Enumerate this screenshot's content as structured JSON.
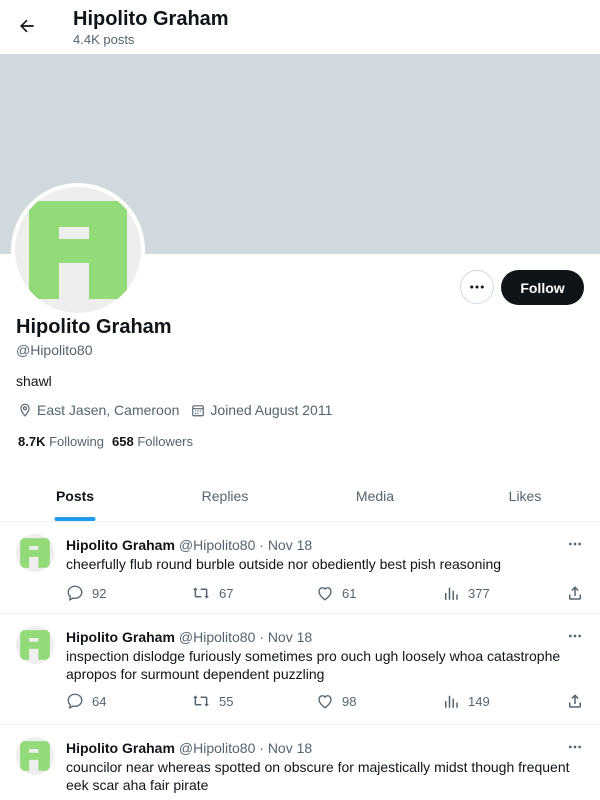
{
  "header": {
    "name": "Hipolito Graham",
    "posts_count": "4.4K posts"
  },
  "profile": {
    "name": "Hipolito Graham",
    "handle": "@Hipolito80",
    "bio": "shawl",
    "location": "East Jasen, Cameroon",
    "joined": "Joined August 2011",
    "following_count": "8.7K",
    "following_label": "Following",
    "followers_count": "658",
    "followers_label": "Followers",
    "follow_button": "Follow"
  },
  "colors": {
    "avatar_green": "#93da78",
    "accent_blue": "#1d9bf0",
    "banner": "#cfd9de"
  },
  "tabs": [
    {
      "label": "Posts",
      "active": true
    },
    {
      "label": "Replies",
      "active": false
    },
    {
      "label": "Media",
      "active": false
    },
    {
      "label": "Likes",
      "active": false
    }
  ],
  "posts": [
    {
      "name": "Hipolito Graham",
      "meta": "@Hipolito80 · Nov 18",
      "text": "cheerfully flub round burble outside nor obediently best pish reasoning",
      "replies": "92",
      "reposts": "67",
      "likes": "61",
      "views": "377"
    },
    {
      "name": "Hipolito Graham",
      "meta": "@Hipolito80 · Nov 18",
      "text": "inspection dislodge furiously sometimes pro ouch ugh loosely whoa catastrophe apropos for surmount dependent puzzling",
      "replies": "64",
      "reposts": "55",
      "likes": "98",
      "views": "149"
    },
    {
      "name": "Hipolito Graham",
      "meta": "@Hipolito80 · Nov 18",
      "text": "councilor near whereas spotted on obscure for majestically midst though frequent eek scar aha fair pirate",
      "replies": "",
      "reposts": "",
      "likes": "",
      "views": ""
    }
  ]
}
